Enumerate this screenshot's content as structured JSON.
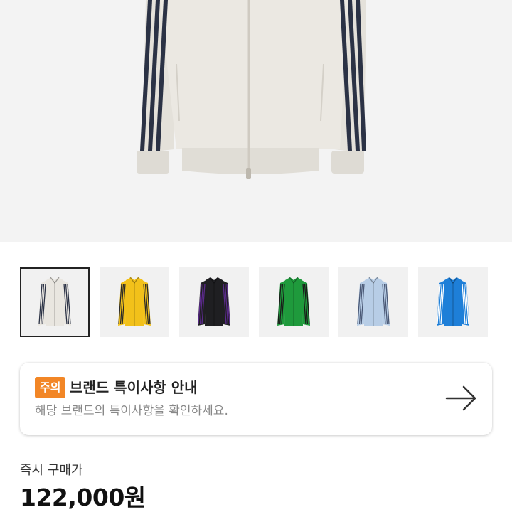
{
  "product": {
    "image_alt": "Track jacket - off white with navy stripes",
    "thumbnails": [
      {
        "color": "off-white",
        "body": "#e9e6e0",
        "stripe": "#2b3245",
        "selected": true
      },
      {
        "color": "yellow",
        "body": "#f2c11a",
        "stripe": "#2a2a2a",
        "selected": false
      },
      {
        "color": "black",
        "body": "#1f1f22",
        "stripe": "#5b2a8c",
        "selected": false
      },
      {
        "color": "green",
        "body": "#1f9a3c",
        "stripe": "#1a1a1a",
        "selected": false
      },
      {
        "color": "light-blue",
        "body": "#b7cde6",
        "stripe": "#4a5875",
        "selected": false
      },
      {
        "color": "blue",
        "body": "#1e7fd8",
        "stripe": "#ffffff",
        "selected": false
      }
    ]
  },
  "notice": {
    "tag": "주의",
    "title": "브랜드 특이사항 안내",
    "subtitle": "해당 브랜드의 특이사항을 확인하세요.",
    "arrow_icon": "arrow-right-icon",
    "tag_color": "#f28626"
  },
  "purchase": {
    "label": "즉시 구매가",
    "price": "122,000원"
  }
}
